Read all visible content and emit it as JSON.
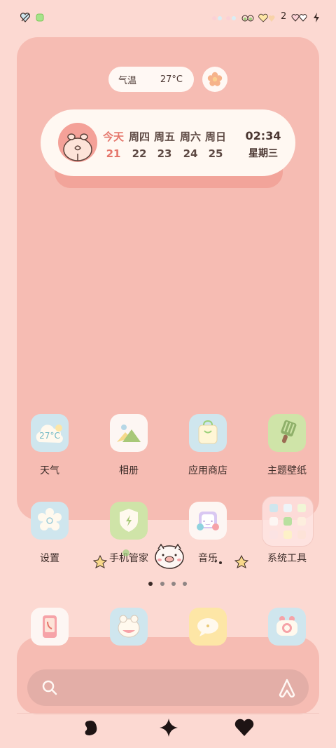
{
  "status_bar": {
    "notification_count": "2",
    "icons": [
      "heart-crossed-icon",
      "green-dot-icon",
      "bows-icon",
      "hearts-icon",
      "charging-bolt-icon"
    ]
  },
  "weather_widget": {
    "label": "气温",
    "value": "27°C"
  },
  "calendar_widget": {
    "days": [
      {
        "name": "今天",
        "date": "21"
      },
      {
        "name": "周四",
        "date": "22"
      },
      {
        "name": "周五",
        "date": "23"
      },
      {
        "name": "周六",
        "date": "24"
      },
      {
        "name": "周日",
        "date": "25"
      }
    ],
    "time": "02:34",
    "weekday": "星期三"
  },
  "apps": [
    {
      "label": "天气",
      "icon": "cloud-weather-icon",
      "icon_text": "27°C"
    },
    {
      "label": "相册",
      "icon": "photo-mountain-icon"
    },
    {
      "label": "应用商店",
      "icon": "shopping-bag-icon"
    },
    {
      "label": "主题壁纸",
      "icon": "paint-brush-icon"
    },
    {
      "label": "设置",
      "icon": "gear-flower-icon"
    },
    {
      "label": "手机管家",
      "icon": "shield-bolt-icon"
    },
    {
      "label": "音乐",
      "icon": "headphones-icon"
    },
    {
      "label": "系统工具",
      "icon": "folder-grid-icon"
    }
  ],
  "dock_apps": [
    {
      "icon": "phone-icon"
    },
    {
      "icon": "frog-chat-icon"
    },
    {
      "icon": "message-bubble-icon"
    },
    {
      "icon": "camera-icon"
    }
  ],
  "page_indicator": {
    "count": 4,
    "active": 1
  },
  "search": {
    "icon": "search-icon",
    "right_icon": "app-logo-icon"
  },
  "nav": {
    "icons": [
      "back-blob-icon",
      "home-sparkle-icon",
      "recents-heart-icon"
    ]
  },
  "colors": {
    "background": "#fcd9d2",
    "panel": "#f6bcb3",
    "accent": "#e5766b"
  }
}
